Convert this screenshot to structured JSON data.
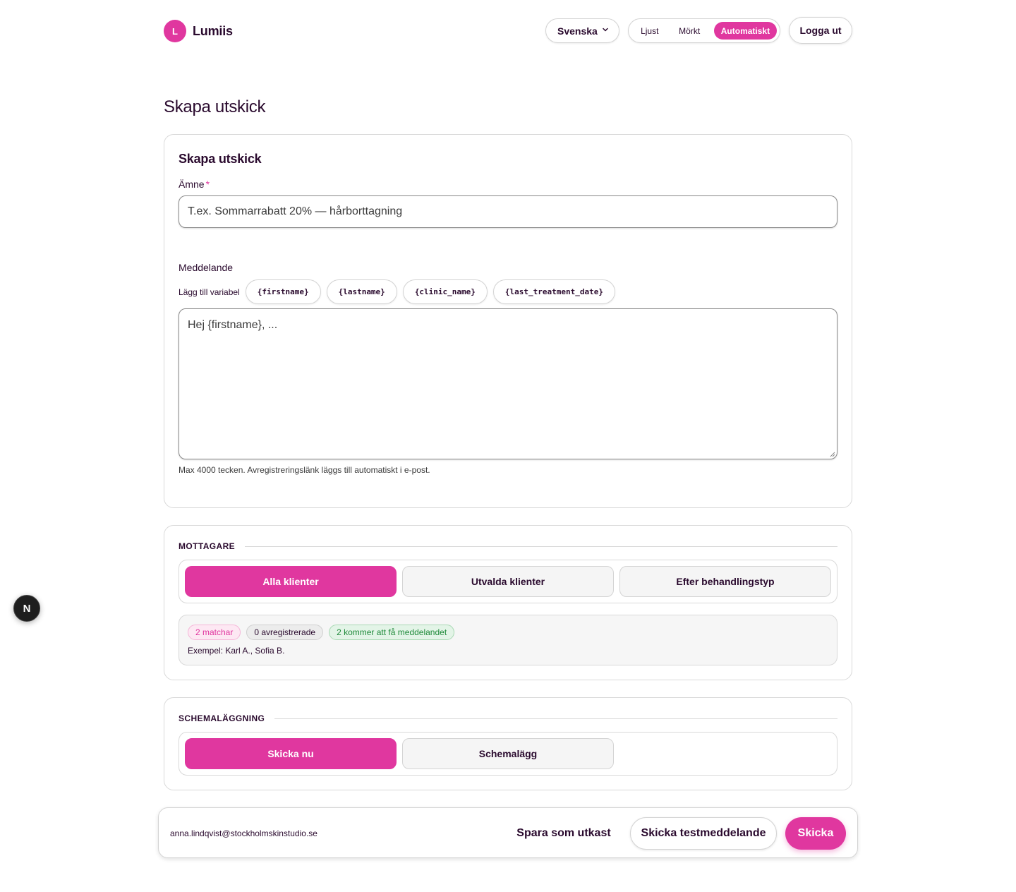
{
  "header": {
    "logo_letter": "L",
    "brand": "Lumiis",
    "language": "Svenska",
    "theme_options": [
      "Ljust",
      "Mörkt",
      "Automatiskt"
    ],
    "theme_selected": "Automatiskt",
    "logout": "Logga ut"
  },
  "page": {
    "title": "Skapa utskick"
  },
  "compose": {
    "title": "Skapa utskick",
    "subject_label": "Ämne",
    "subject_required_mark": "*",
    "subject_placeholder": "T.ex. Sommarrabatt 20% — hårborttagning",
    "message_label": "Meddelande",
    "variables_label": "Lägg till variabel",
    "variables": [
      "{firstname}",
      "{lastname}",
      "{clinic_name}",
      "{last_treatment_date}"
    ],
    "message_placeholder": "Hej {firstname}, ...",
    "help": "Max 4000 tecken. Avregistreringslänk läggs till automatiskt i e-post."
  },
  "recipients": {
    "title": "MOTTAGARE",
    "options": [
      "Alla klienter",
      "Utvalda klienter",
      "Efter behandlingstyp"
    ],
    "selected": "Alla klienter",
    "badges": {
      "matches": "2 matchar",
      "unsubscribed": "0 avregistrerade",
      "will_receive": "2 kommer att få meddelandet"
    },
    "example": "Exempel: Karl A., Sofia B."
  },
  "schedule": {
    "title": "SCHEMALÄGGNING",
    "options": [
      "Skicka nu",
      "Schemalägg"
    ],
    "selected": "Skicka nu"
  },
  "footer": {
    "sender_email": "anna.lindqvist@stockholmskinstudio.se",
    "save_draft": "Spara som utkast",
    "send_test": "Skicka testmeddelande",
    "send": "Skicka"
  },
  "dev_badge": "N",
  "colors": {
    "accent": "#e0379f",
    "text": "#2a0a2e",
    "success": "#1f8a3a"
  }
}
